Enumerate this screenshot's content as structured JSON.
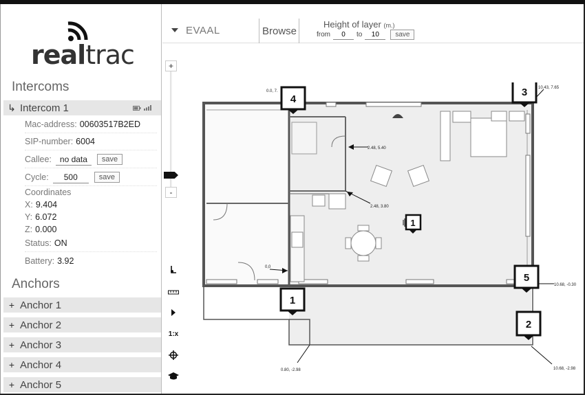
{
  "logo": {
    "part1": "real",
    "part2": "trac"
  },
  "intercoms": {
    "title": "Intercoms",
    "items": [
      {
        "label": "Intercom 1",
        "mac_label": "Mac-address:",
        "mac": "00603517B2ED",
        "sip_label": "SIP-number:",
        "sip": "6004",
        "callee_label": "Callee:",
        "callee": "no data",
        "cycle_label": "Cycle:",
        "cycle": "500",
        "coords_label": "Coordinates",
        "x_label": "X:",
        "x": "9.404",
        "y_label": "Y:",
        "y": "6.072",
        "z_label": "Z:",
        "z": "0.000",
        "status_label": "Status:",
        "status": "ON",
        "battery_label": "Battery:",
        "battery": "3.92"
      }
    ],
    "save_label": "save"
  },
  "anchors": {
    "title": "Anchors",
    "items": [
      "Anchor 1",
      "Anchor 2",
      "Anchor 3",
      "Anchor 4",
      "Anchor 5"
    ]
  },
  "toolbar": {
    "project": "EVAAL",
    "browse": "Browse",
    "height_title": "Height of layer",
    "height_unit": "(m.)",
    "from_label": "from",
    "from_value": "0",
    "to_label": "to",
    "to_value": "10",
    "save_label": "save"
  },
  "zoom": {
    "plus": "+",
    "minus": "-"
  },
  "tools": {
    "scale_label": "1:x"
  },
  "map": {
    "anchor_labels": [
      "1",
      "2",
      "3",
      "4",
      "5"
    ],
    "intercom_label": "1",
    "coord_labels": {
      "c00": "0,0",
      "c0775": "0.0, 7.",
      "c1043": "10.43, 7.65",
      "c248_540": "2.48, 5.40",
      "c248_380": "2.48, 3.80",
      "c1068_030": "10.68, -0.30",
      "c080_298": "0.80, -2.98",
      "c1068_298": "10.68, -2.98"
    }
  },
  "colors": {
    "accent": "#111111",
    "row_bg": "#e6e6e6",
    "floor": "#eeeeee",
    "wall": "#555555"
  }
}
